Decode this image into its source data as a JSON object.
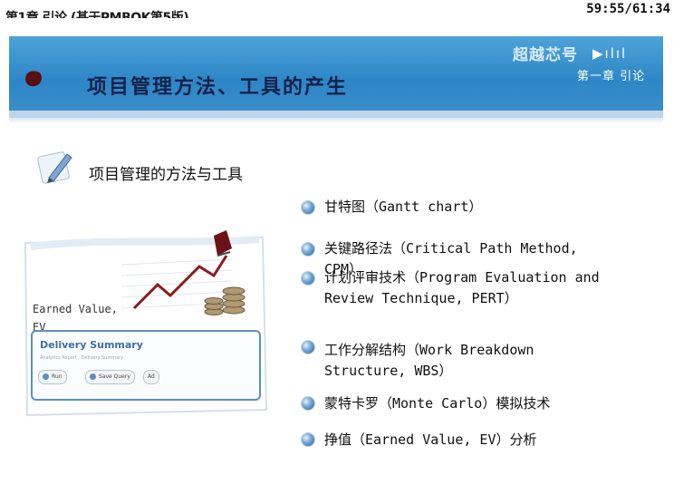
{
  "header": {
    "chapter_title": "第1章 引论 (基于PMBOK第5版)",
    "timer": "59:55/61:34"
  },
  "banner": {
    "title": "项目管理方法、工具的产生",
    "brand": "超越芯号",
    "chapter_tag": "第一章 引论"
  },
  "section": {
    "title": "项目管理的方法与工具"
  },
  "items": [
    {
      "text": "甘特图（Gantt chart）"
    },
    {
      "text": "关键路径法（Critical Path Method,\nCPM）"
    },
    {
      "text": "计划评审技术（Program Evaluation and\nReview Technique, PERT）"
    },
    {
      "text": "工作分解结构（Work Breakdown\nStructure, WBS）"
    },
    {
      "text": "蒙特卡罗（Monte Carlo）模拟技术"
    },
    {
      "text": "挣值（Earned Value, EV）分析"
    }
  ],
  "illustration": {
    "ev_label": "Earned Value,\nEV",
    "panel_title": "Delivery Summary",
    "panel_subtitle": "Analytics Report · Delivery Summary",
    "buttons": [
      "Run",
      "Save Query",
      "Ad"
    ]
  },
  "colors": {
    "banner": "#2d86c6",
    "title": "#16214a",
    "chart_line": "#8b1a1a"
  }
}
